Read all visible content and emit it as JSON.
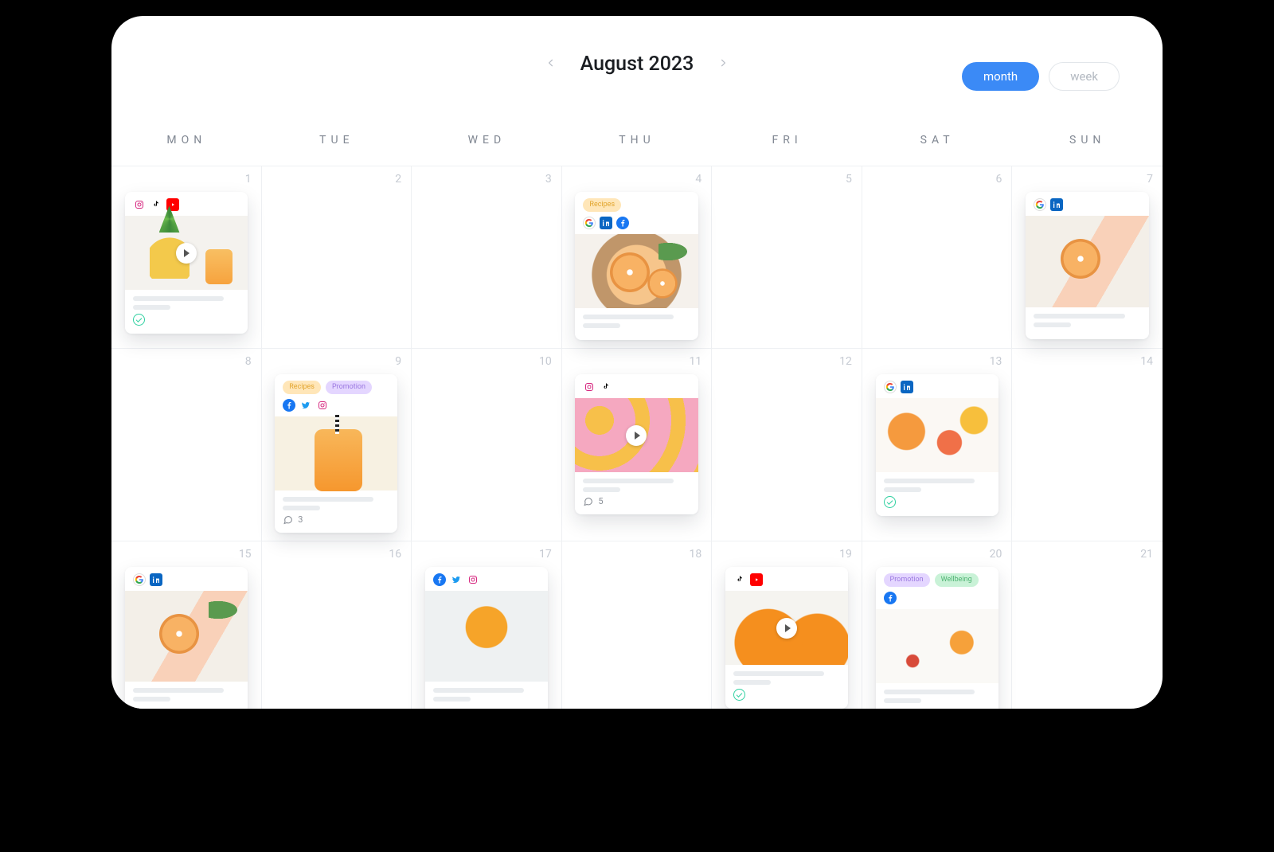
{
  "header": {
    "month_label": "August 2023",
    "view": {
      "month": "month",
      "week": "week"
    }
  },
  "dow": [
    "MON",
    "TUE",
    "WED",
    "THU",
    "FRI",
    "SAT",
    "SUN"
  ],
  "weeks": [
    {
      "days": [
        {
          "num": "1",
          "card": {
            "networks": [
              "ig",
              "tk",
              "yt"
            ],
            "video": true,
            "thumb": "img-pineapple",
            "thumbExtras": [
              "fruit-pine",
              "fruit-glass"
            ],
            "approved": true
          }
        },
        {
          "num": "2"
        },
        {
          "num": "3"
        },
        {
          "num": "4",
          "card": {
            "tags": [
              [
                "Recipes",
                "tag-recipes"
              ]
            ],
            "networks": [
              "g",
              "li",
              "fb"
            ],
            "thumb": "img-board",
            "thumbExtras": [
              "fruit-slice s1",
              "fruit-slice s2",
              "fruit-leaf"
            ]
          }
        },
        {
          "num": "5"
        },
        {
          "num": "6"
        },
        {
          "num": "7",
          "card": {
            "networks": [
              "g",
              "li"
            ],
            "thumb": "img-cloth",
            "thumbExtras": [
              "fruit-slice s1"
            ],
            "tall": true
          }
        }
      ]
    },
    {
      "days": [
        {
          "num": "8"
        },
        {
          "num": "9",
          "card": {
            "tags": [
              [
                "Recipes",
                "tag-recipes"
              ],
              [
                "Promotion",
                "tag-promotion"
              ]
            ],
            "networks": [
              "fb",
              "tw",
              "ig"
            ],
            "thumb": "img-smoothie",
            "thumbExtras": [
              "bigglass"
            ],
            "comments": "3"
          }
        },
        {
          "num": "10"
        },
        {
          "num": "11",
          "card": {
            "networks": [
              "ig",
              "tk"
            ],
            "video": true,
            "thumb": "img-chips",
            "comments": "5"
          }
        },
        {
          "num": "12"
        },
        {
          "num": "13",
          "card": {
            "networks": [
              "g",
              "li"
            ],
            "thumb": "img-citrus",
            "approved": true
          }
        },
        {
          "num": "14"
        }
      ]
    },
    {
      "days": [
        {
          "num": "15",
          "card": {
            "networks": [
              "g",
              "li"
            ],
            "thumb": "img-cloth",
            "thumbExtras": [
              "fruit-slice s1",
              "fruit-leaf"
            ],
            "tall": true
          }
        },
        {
          "num": "16"
        },
        {
          "num": "17",
          "card": {
            "networks": [
              "fb",
              "tw",
              "ig"
            ],
            "thumb": "img-oranges",
            "tall": true
          }
        },
        {
          "num": "18"
        },
        {
          "num": "19",
          "card": {
            "networks": [
              "tk",
              "yt"
            ],
            "video": true,
            "thumb": "img-whole",
            "approved": true
          }
        },
        {
          "num": "20",
          "card": {
            "tags": [
              [
                "Promotion",
                "tag-promotion"
              ],
              [
                "Wellbeing",
                "tag-wellbeing"
              ]
            ],
            "networks": [
              "fb"
            ],
            "thumb": "img-flatlay"
          }
        },
        {
          "num": "21"
        }
      ]
    }
  ],
  "tag_labels": {
    "Recipes": "Recipes",
    "Promotion": "Promotion",
    "Wellbeing": "Wellbeing"
  }
}
